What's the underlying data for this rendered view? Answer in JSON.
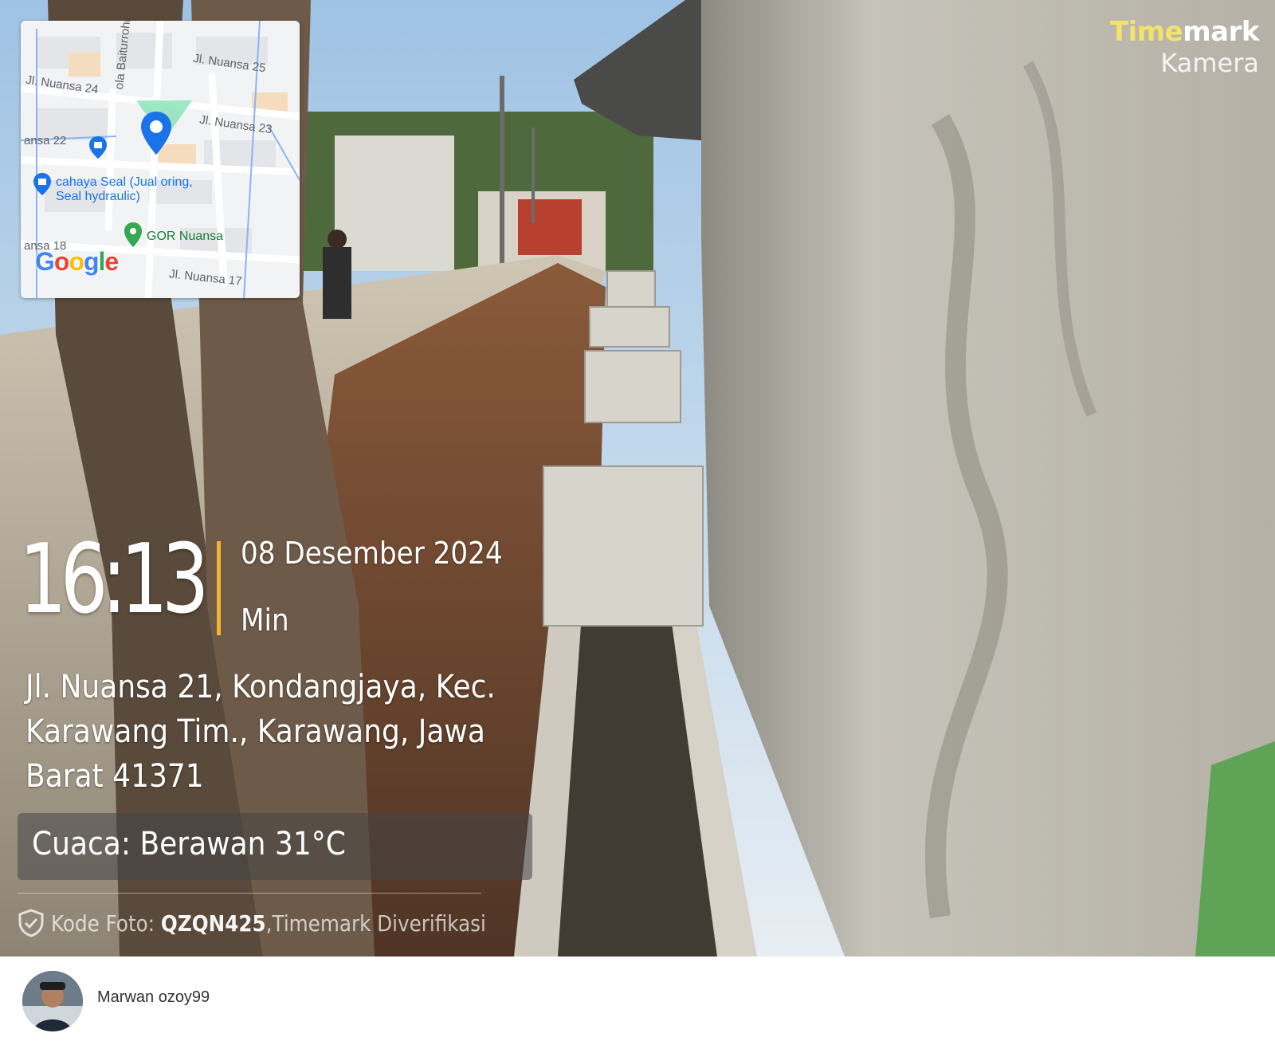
{
  "map": {
    "streets": [
      "Jl. Nuansa 25",
      "Jl. Nuansa 24",
      "Jl. Nuansa 23",
      "ansa 22",
      "ansa 18",
      "Jl. Nuansa 17",
      "ola Baiturrohir"
    ],
    "poi_cahaya": "cahaya Seal (Jual oring, Seal hydraulic)",
    "poi_gor": "GOR Nuansa",
    "google_logo": [
      "G",
      "o",
      "o",
      "g",
      "l",
      "e"
    ],
    "google_colors": [
      "#4285F4",
      "#EA4335",
      "#FBBC05",
      "#4285F4",
      "#34A853",
      "#EA4335"
    ]
  },
  "brand": {
    "title_part1": "Time",
    "title_part2": "mark",
    "subtitle": "Kamera"
  },
  "overlay": {
    "time": "16:13",
    "date": "08 Desember 2024",
    "day": "Min",
    "address": "Jl. Nuansa 21, Kondangjaya, Kec. Karawang Tim., Karawang, Jawa Barat 41371",
    "weather": "Cuaca: Berawan 31°C",
    "photo_code_label": "Kode Foto: ",
    "photo_code": "QZQN425",
    "verified": ",Timemark Diverifikasi",
    "accent_color": "#f2b531"
  },
  "footer": {
    "author": "Marwan ozoy99"
  },
  "icons": [
    "map-pin-icon",
    "shop-pin-icon",
    "place-pin-icon",
    "shield-check-icon"
  ]
}
